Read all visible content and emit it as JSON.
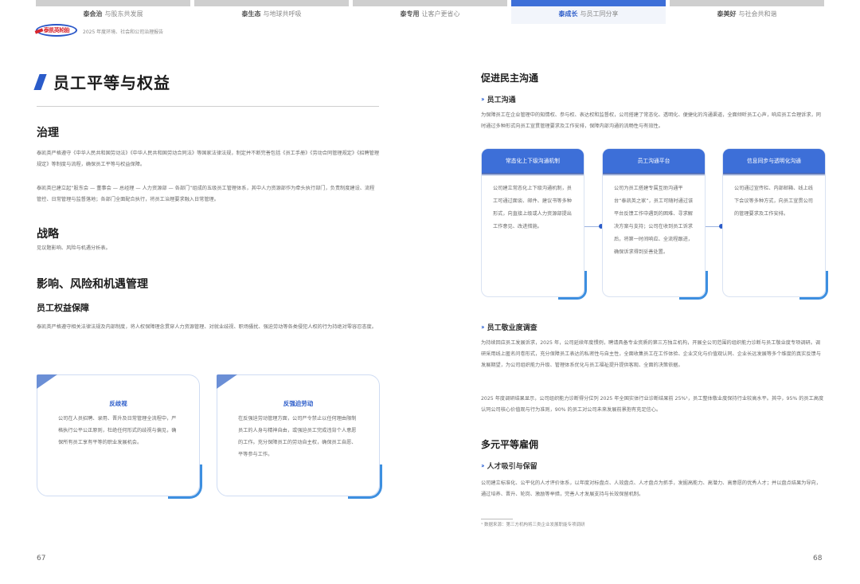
{
  "tabs": [
    {
      "bold": "泰会治",
      "text": "与股东共发展",
      "active": false
    },
    {
      "bold": "泰生态",
      "text": "与地球共呼吸",
      "active": false
    },
    {
      "bold": "泰专用",
      "text": "让客户更省心",
      "active": false
    },
    {
      "bold": "泰成长",
      "text": "与员工同分享",
      "active": true
    },
    {
      "bold": "泰美好",
      "text": "与社会共和谐",
      "active": false
    }
  ],
  "header": {
    "logo_text": "泰凯英轮胎",
    "report_name": "2025 年度环境、社会和公司治理报告"
  },
  "left": {
    "title": "员工平等与权益",
    "governance": {
      "heading": "治理",
      "p1": "泰凯英严格遵守《中华人民共和国劳动法》《中华人民共和国劳动合同法》等国家法律法规，制定并不断完善包括《员工手册》《劳动合同管理规定》《招聘管理规定》等制度与流程，确保员工平等与权益保障。",
      "p2": "泰凯英已建立起“股东会 — 董事会 — 总经理 — 人力资源部 — 各部门”组成的五级员工管理体系，其中人力资源部作为牵头执行部门，负责制度建设、流程管控、日常管理与监督落地；各部门全面配合执行，将员工治理要求融入日常管理。"
    },
    "strategy": {
      "heading": "战略",
      "p1": "见议题影响、风险与机遇分析表。"
    },
    "impact": {
      "heading": "影响、风险和机遇管理",
      "subheading": "员工权益保障",
      "p1": "泰凯英严格遵守相关法律法规及内部制度，将人权保障理念贯穿人力资源管理、对就业歧视、职场骚扰、强迫劳动等各类侵犯人权的行为持绝对零容忍态度。"
    },
    "cards": [
      {
        "title": "反歧视",
        "body": "公司在人员招聘、录用、晋升及日常管理全流程中，严格执行公平公正原则，杜绝任何形式的歧视与偏见，确保所有员工享有平等的职业发展机会。"
      },
      {
        "title": "反强迫劳动",
        "body": "在反强迫劳动管理方面，公司严令禁止以任何理由限制员工的人身与精神自由，或强迫员工完成违背个人意愿的工作。充分保障员工的劳动自主权，确保员工自愿、平等参与工作。"
      }
    ],
    "page_number": "67"
  },
  "right": {
    "section1": {
      "heading": "促进民主沟通",
      "sub1": "员工沟通",
      "p1": "为保障员工在企业管理中的知情权、参与权、表达权和监督权，公司搭建了常态化、透明化、便捷化的沟通渠道，全面倾听员工心声，响应员工合理诉求，同时通过多种形式向员工宣贯管理要求及工作安排，保障内部沟通的流畅性与有效性。"
    },
    "flow_cards": [
      {
        "title": "常态化上下级沟通机制",
        "body": "公司建立常态化上下级沟通机制，员工可通过面谈、邮件、建议书等多种形式，向直接上级或人力资源部提出工作意见、改进措施。"
      },
      {
        "title": "员工沟通平台",
        "body": "公司为员工搭建专属互助沟通平台“泰凯英之家”，员工可随时通过该平台反馈工作中遇到的困难、寻求解决方案与支持；公司在收到员工诉求后，将第一时间响应、全流程跟进，确保诉求得到妥善处置。"
      },
      {
        "title": "信息同步与透明化沟通",
        "body": "公司通过宣传栏、内部邮箱、线上线下会议等多种方式，向员工宣贯公司的管理要求及工作安排。"
      }
    ],
    "section2": {
      "sub": "员工敬业度调查",
      "p1": "为持续回应员工发展诉求，2025 年，公司延续年度惯例，聘请具备专业资质的第三方独立机构，开展全公司范围的组织能力诊断与员工敬业度专项调研。调研采用线上匿名问卷形式，充分保障员工表达的私密性与自主性，全面收集员工在工作体验、企业文化与价值观认同、企业长远发展等多个维度的真实反馈与发展期望，为公司组织能力升级、管理体系优化与员工福祉提升提供客观、全面的决策依据。",
      "p2": "2025 年度调研结果显示，公司组织能力诊断得分位列 2025 年全国实体行业诊断结果前 25%¹，员工整体敬业度保持行业较高水平。其中，95% 的员工高度认同公司核心价值观与行为准则，90% 的员工对公司未来发展前景抱有充足信心。"
    },
    "section3": {
      "heading": "多元平等雇佣",
      "sub": "人才吸引与保留",
      "p1": "公司建立标准化、公平化的人才评价体系，以年度对标盘点、人效盘点、人才盘点为抓手，发掘高能力、高潜力、高意愿的优秀人才；并以盘点结果为导向，通过培养、晋升、轮岗、激励等举措，完善人才发展支持与长效保留机制。"
    },
    "footnote": "¹ 数据来源：第三方机构将三类企业发展职能专项调研",
    "page_number": "68"
  },
  "colors": {
    "accent": "#2a5bc9",
    "tab_active": "#3d6fd8",
    "card_border": "#cfdcf3"
  }
}
